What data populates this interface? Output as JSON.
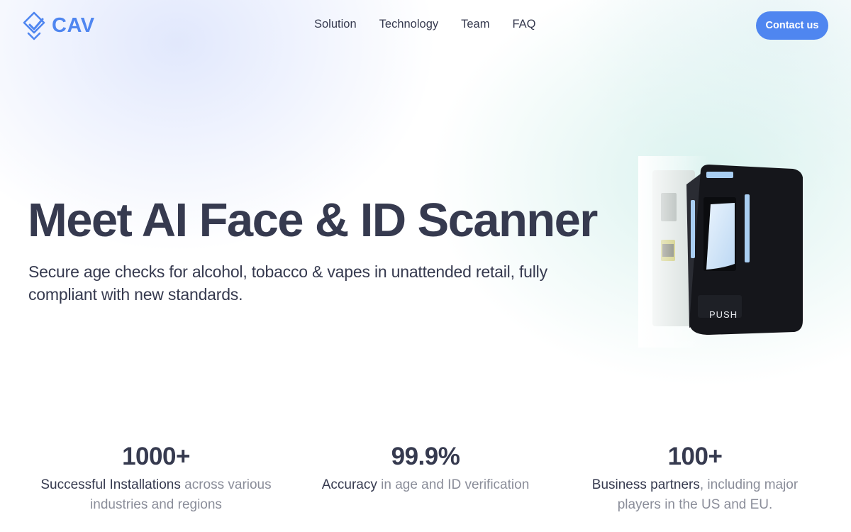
{
  "header": {
    "logo_text": "CAV",
    "nav": [
      "Solution",
      "Technology",
      "Team",
      "FAQ"
    ],
    "cta_label": "Contact us"
  },
  "hero": {
    "title": "Meet AI Face & ID Scanner",
    "subtitle": "Secure age checks for alcohol, tobacco & vapes in unattended retail, fully compliant with new standards.",
    "device_label": "PUSH"
  },
  "stats": [
    {
      "value": "1000+",
      "highlight": "Successful Installations",
      "rest": " across various industries and regions"
    },
    {
      "value": "99.9%",
      "highlight": "Accuracy",
      "rest": " in age and ID verification"
    },
    {
      "value": "100+",
      "highlight": "Business partners",
      "rest": ", including major players in the US and EU."
    }
  ],
  "colors": {
    "accent": "#4f86f0",
    "text": "#363a4f",
    "muted": "#8a8d99",
    "device": "#15161b"
  },
  "icons": {
    "logo": "shield-check-logo-icon"
  }
}
